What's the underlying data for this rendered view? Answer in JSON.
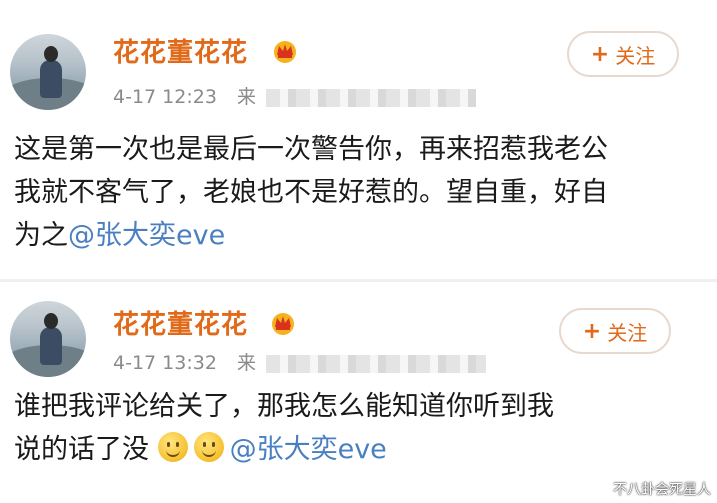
{
  "posts": [
    {
      "username": "花花董花花",
      "timestamp": "4-17 12:23",
      "source_prefix": "来",
      "follow_label": "关注",
      "follow_plus": "+",
      "text_lines": [
        "这是第一次也是最后一次警告你，再来招惹我老公",
        "我就不客气了，老娘也不是好惹的。望自重，好自"
      ],
      "text_last": "为之",
      "mention": "@张大奕eve"
    },
    {
      "username": "花花董花花",
      "timestamp": "4-17 13:32",
      "source_prefix": "来",
      "follow_label": "关注",
      "follow_plus": "+",
      "text_lines": [
        "谁把我评论给关了，那我怎么能知道你听到我"
      ],
      "text_last": "说的话了没",
      "emojis": [
        "smile-emoji",
        "smile-emoji"
      ],
      "mention": "@张大奕eve"
    }
  ],
  "watermark": "不八卦会死星人",
  "colors": {
    "username": "#e06a1a",
    "mention": "#4a7fc1",
    "meta": "#8a8a8a"
  }
}
